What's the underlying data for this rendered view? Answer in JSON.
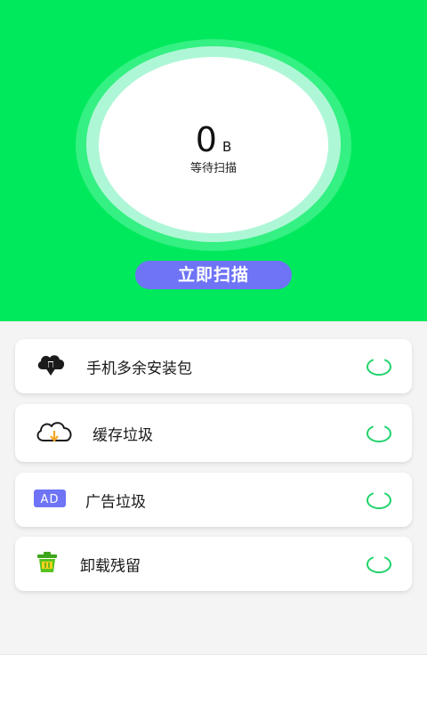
{
  "scan": {
    "size_value": "0",
    "size_unit": "B",
    "status": "等待扫描",
    "button_label": "立即扫描"
  },
  "items": [
    {
      "label": "手机多余安装包",
      "icon": "package-download-icon"
    },
    {
      "label": "缓存垃圾",
      "icon": "cloud-download-icon"
    },
    {
      "label": "广告垃圾",
      "icon": "ad-icon",
      "icon_text": "AD"
    },
    {
      "label": "卸载残留",
      "icon": "trash-bin-icon"
    }
  ],
  "colors": {
    "header_bg": "#00e95c",
    "button_bg": "#6e74f5",
    "spinner": "#1fd36b",
    "ad_badge": "#6e74f5",
    "bin": "#5ac41f",
    "cloud_arrow": "#f5a623"
  }
}
